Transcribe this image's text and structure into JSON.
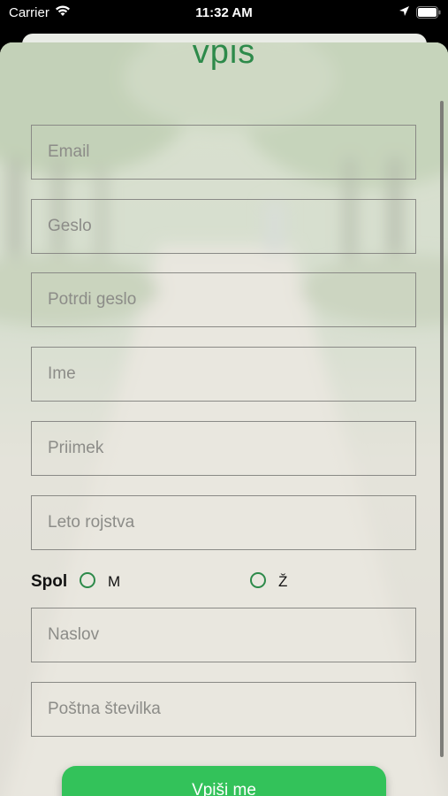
{
  "status_bar": {
    "carrier": "Carrier",
    "time": "11:32 AM",
    "icons": [
      "wifi-icon",
      "location-arrow-icon",
      "battery-icon"
    ]
  },
  "form": {
    "title": "vpis",
    "fields": {
      "email": {
        "placeholder": "Email",
        "value": ""
      },
      "password": {
        "placeholder": "Geslo",
        "value": ""
      },
      "confirm_password": {
        "placeholder": "Potrdi geslo",
        "value": ""
      },
      "first_name": {
        "placeholder": "Ime",
        "value": ""
      },
      "last_name": {
        "placeholder": "Priimek",
        "value": ""
      },
      "birth_year": {
        "placeholder": "Leto rojstva",
        "value": ""
      },
      "address": {
        "placeholder": "Naslov",
        "value": ""
      },
      "postal_code": {
        "placeholder": "Poštna številka",
        "value": ""
      }
    },
    "gender": {
      "label": "Spol",
      "options": [
        "M",
        "Ž"
      ],
      "selected": null
    },
    "submit_label": "Vpiši me"
  },
  "colors": {
    "accent": "#2d8a4a",
    "button": "#33c25a",
    "field_border": "#8a8a86",
    "placeholder": "#8c8c88"
  }
}
